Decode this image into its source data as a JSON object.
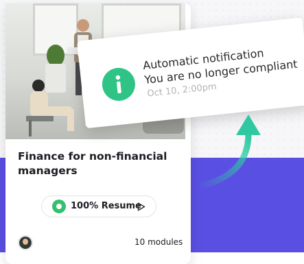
{
  "course": {
    "title": "Finance for non-financial managers",
    "progress_percent": 100,
    "resume_label": "100% Resume",
    "modules_label": "10 modules"
  },
  "notification": {
    "line1": "Automatic notification",
    "line2": "You are no longer compliant",
    "time": "Oct 10, 2:00pm"
  },
  "icons": {
    "info": "info-icon",
    "play": "play-icon",
    "arrow": "curved-arrow-icon"
  },
  "colors": {
    "accent_purple": "#5a4fe3",
    "success_green": "#35c06f",
    "info_green": "#2fc486",
    "arrow_teal": "#2ec9a0"
  }
}
